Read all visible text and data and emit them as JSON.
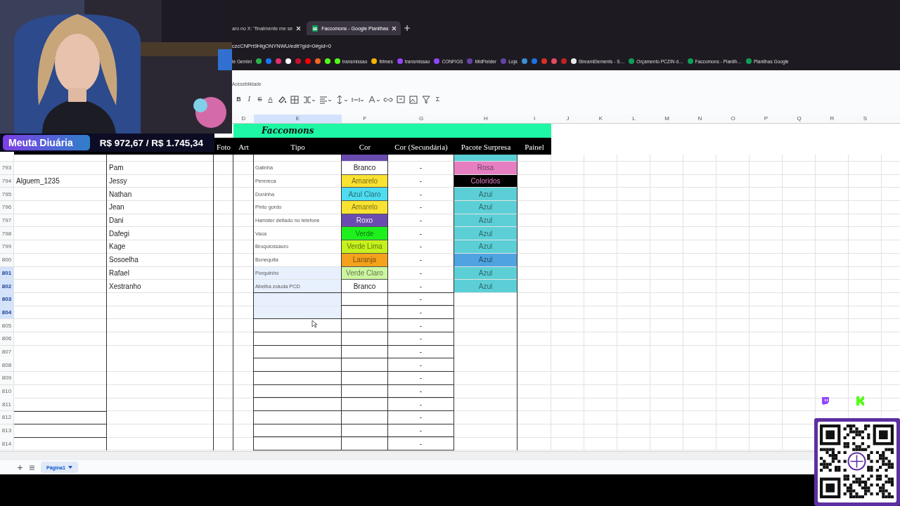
{
  "browser": {
    "tabs": [
      {
        "title": "aro no X: \"finalmente me se",
        "selected": false
      },
      {
        "title": "Faccomons - Google Planilhas",
        "selected": true
      }
    ],
    "url": "czcCNPrt9HlgONYNWU/edit?gid=0#gid=0",
    "bookmarks": [
      {
        "label": "le Gemini"
      },
      {
        "color": "#2bb24c"
      },
      {
        "color": "#1877f2"
      },
      {
        "color": "#e1306c"
      },
      {
        "color": "#ffffff"
      },
      {
        "color": "#c8102e"
      },
      {
        "color": "#ff0000"
      },
      {
        "color": "#f26522"
      },
      {
        "color": "#53fc18"
      },
      {
        "label": "transmissao",
        "color": "#53fc18"
      },
      {
        "label": "firlmes",
        "color": "#f4b400"
      },
      {
        "label": "transmissao",
        "color": "#9146ff"
      },
      {
        "label": "CONFIGS",
        "color": "#9146ff"
      },
      {
        "label": "MidFielder",
        "color": "#6441a5"
      },
      {
        "label": "Loja",
        "color": "#6441a5"
      },
      {
        "color": "#3a8fd8"
      },
      {
        "color": "#1a73e8"
      },
      {
        "color": "#d93025"
      },
      {
        "color": "#e84a5f"
      },
      {
        "color": "#c5221f"
      },
      {
        "label": "StreamElements - S…",
        "color": "#e8e8e8"
      },
      {
        "label": "Orçamento PCZIN d…",
        "color": "#0f9d58"
      },
      {
        "label": "Faccomons - Planilh…",
        "color": "#0f9d58"
      },
      {
        "label": "Planilhas Google",
        "color": "#0f9d58"
      }
    ]
  },
  "menu_hint": "Acessibilidade",
  "toolbar": [
    {
      "kind": "bold",
      "text": "B"
    },
    {
      "kind": "italic",
      "text": "I"
    },
    {
      "kind": "strike",
      "text": "S"
    },
    {
      "kind": "underline",
      "text": "A"
    },
    {
      "kind": "icon"
    },
    {
      "kind": "icon"
    },
    {
      "kind": "icon"
    },
    {
      "kind": "icon"
    },
    {
      "kind": "icon"
    },
    {
      "kind": "icon"
    },
    {
      "kind": "icon"
    },
    {
      "kind": "icon"
    },
    {
      "kind": "icon"
    },
    {
      "kind": "icon"
    },
    {
      "kind": "icon"
    },
    {
      "kind": "plain",
      "text": "Σ"
    }
  ],
  "column_headers": [
    {
      "letter": "D",
      "selected": false
    },
    {
      "letter": "E",
      "selected": true
    },
    {
      "letter": "F",
      "selected": false
    },
    {
      "letter": "G",
      "selected": false
    },
    {
      "letter": "H",
      "selected": false
    },
    {
      "letter": "I",
      "selected": false
    },
    {
      "letter": "J",
      "selected": false
    },
    {
      "letter": "K",
      "selected": false
    },
    {
      "letter": "L",
      "selected": false
    },
    {
      "letter": "M",
      "selected": false
    },
    {
      "letter": "N",
      "selected": false
    },
    {
      "letter": "O",
      "selected": false
    },
    {
      "letter": "P",
      "selected": false
    },
    {
      "letter": "Q",
      "selected": false
    },
    {
      "letter": "R",
      "selected": false
    },
    {
      "letter": "S",
      "selected": false
    }
  ],
  "sheet_title": "Faccomons",
  "header_labels": [
    "Foto",
    "Art",
    "Tipo",
    "Cor",
    "Cor (Secundária)",
    "Pacote Surpresa",
    "Painel"
  ],
  "partial_row": {
    "cor": {
      "color": "#6a4cb0"
    },
    "pacote": {
      "color": "#5ccfd6"
    }
  },
  "rows": [
    {
      "number": "793",
      "selected": false,
      "name": "Pam",
      "tipo": "Galinha",
      "cor": {
        "text": "Branco",
        "color": "#ffffff"
      },
      "secundaria": "-",
      "pacote": {
        "text": "Rosa",
        "color": "#e57fc2"
      }
    },
    {
      "number": "794",
      "selected": false,
      "owner": "Alguem_1235",
      "name": "Jessy",
      "tipo": "Perereca",
      "cor": {
        "text": "Amarelo",
        "color": "#f9e231"
      },
      "secundaria": "-",
      "pacote": {
        "text": "Coloridos",
        "color": "#000000"
      }
    },
    {
      "number": "795",
      "selected": false,
      "name": "Nathan",
      "tipo": "Doninha",
      "cor": {
        "text": "Azul Claro",
        "color": "#4ddcf0"
      },
      "secundaria": "-",
      "pacote": {
        "text": "Azul",
        "color": "#5ccfd6"
      }
    },
    {
      "number": "796",
      "selected": false,
      "name": "Jean",
      "tipo": "Pinto gordo",
      "cor": {
        "text": "Amarelo",
        "color": "#f9e231"
      },
      "secundaria": "-",
      "pacote": {
        "text": "Azul",
        "color": "#5ccfd6"
      }
    },
    {
      "number": "797",
      "selected": false,
      "name": "Dani",
      "tipo": "Hamster deitado no telefone",
      "cor": {
        "text": "Roxo",
        "color": "#6a4cb0"
      },
      "secundaria": "-",
      "pacote": {
        "text": "Azul",
        "color": "#5ccfd6"
      }
    },
    {
      "number": "798",
      "selected": false,
      "name": "Dafegi",
      "tipo": "Vaca",
      "cor": {
        "text": "Verde",
        "color": "#1ef01e"
      },
      "secundaria": "-",
      "pacote": {
        "text": "Azul",
        "color": "#5ccfd6"
      }
    },
    {
      "number": "799",
      "selected": false,
      "name": "Kage",
      "tipo": "Broquiossauro",
      "cor": {
        "text": "Verde Lima",
        "color": "#c5f21d"
      },
      "secundaria": "-",
      "pacote": {
        "text": "Azul",
        "color": "#5ccfd6"
      }
    },
    {
      "number": "800",
      "selected": false,
      "name": "Sosoelha",
      "tipo": "Bonequita",
      "cor": {
        "text": "Laranja",
        "color": "#f4a11c"
      },
      "secundaria": "-",
      "pacote": {
        "text": "Azul",
        "color": "#4ea3e0"
      }
    },
    {
      "number": "801",
      "selected": true,
      "name": "Rafael",
      "tipo": "Porquinho",
      "cor": {
        "text": "Verde Claro",
        "color": "#ccf5a0"
      },
      "secundaria": "-",
      "pacote": {
        "text": "Azul",
        "color": "#5ccfd6"
      }
    },
    {
      "number": "802",
      "selected": true,
      "name": "Xestranho",
      "tipo": "Abelha zoiuda PCD",
      "cor": {
        "text": "Branco",
        "color": "#ffffff"
      },
      "secundaria": "-",
      "pacote": {
        "text": "Azul",
        "color": "#5ccfd6"
      }
    },
    {
      "number": "803",
      "selected": true,
      "secundaria": "-"
    },
    {
      "number": "804",
      "selected": true,
      "secundaria": "-"
    },
    {
      "number": "805",
      "selected": false,
      "secundaria": "-"
    },
    {
      "number": "806",
      "selected": false,
      "secundaria": "-"
    },
    {
      "number": "807",
      "selected": false,
      "secundaria": "-"
    },
    {
      "number": "808",
      "selected": false,
      "secundaria": "-"
    },
    {
      "number": "809",
      "selected": false,
      "secundaria": "-"
    },
    {
      "number": "810",
      "selected": false,
      "secundaria": "-"
    },
    {
      "number": "811",
      "selected": false,
      "secundaria": "-"
    },
    {
      "number": "812",
      "selected": false,
      "secundaria": "-"
    },
    {
      "number": "813",
      "selected": false,
      "secundaria": "-"
    },
    {
      "number": "814",
      "selected": false,
      "secundaria": "-"
    }
  ],
  "sheet_tabs": [
    {
      "label": "Página1",
      "selected": true
    }
  ],
  "overlay": {
    "goal_label": "Meuta Diuária",
    "goal_value": "R$ 972,67 / R$ 1.745,34"
  }
}
